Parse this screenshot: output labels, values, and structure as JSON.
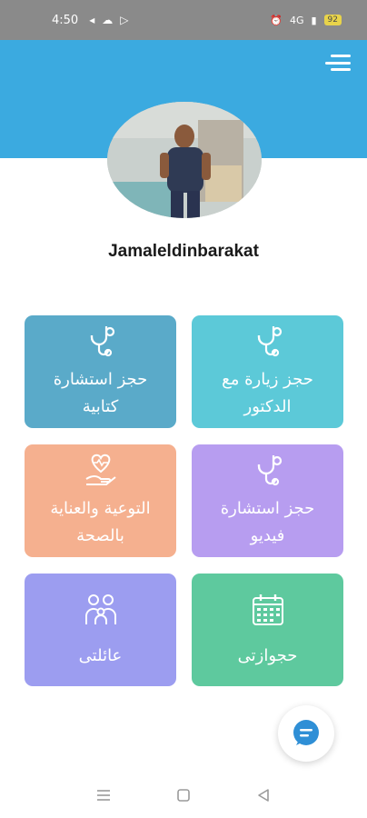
{
  "status_bar": {
    "time": "4:50",
    "left_icons": [
      "notification-icon",
      "cloud-icon",
      "play-store-icon"
    ],
    "right_icons": [
      "alarm-icon",
      "signal-icon"
    ],
    "network": "4G",
    "battery": "92"
  },
  "profile": {
    "username": "Jamaleldinbarakat",
    "avatar_icon": "doctor-photo"
  },
  "cards": [
    {
      "label_line1": "حجز زيارة مع",
      "label_line2": "الدكتور",
      "icon": "stethoscope-icon",
      "color": "#5cc9d8"
    },
    {
      "label_line1": "حجز استشارة",
      "label_line2": "كتابية",
      "icon": "stethoscope-icon",
      "color": "#5aaac9"
    },
    {
      "label_line1": "حجز استشارة",
      "label_line2": "فيديو",
      "icon": "stethoscope-icon",
      "color": "#b79df0"
    },
    {
      "label_line1": "التوعية والعناية",
      "label_line2": "بالصحة",
      "icon": "heart-hand-icon",
      "color": "#f5b08f"
    },
    {
      "label_line1": "حجوازتى",
      "icon": "calendar-icon",
      "color": "#5ec99e"
    },
    {
      "label_line1": "عائلتى",
      "icon": "family-icon",
      "color": "#9c9df0"
    }
  ],
  "header_color": "#3baae0",
  "chat_button": {
    "icon": "chat-icon"
  },
  "nav_bar": {
    "icons": [
      "recent-apps-icon",
      "home-icon",
      "back-icon"
    ]
  }
}
